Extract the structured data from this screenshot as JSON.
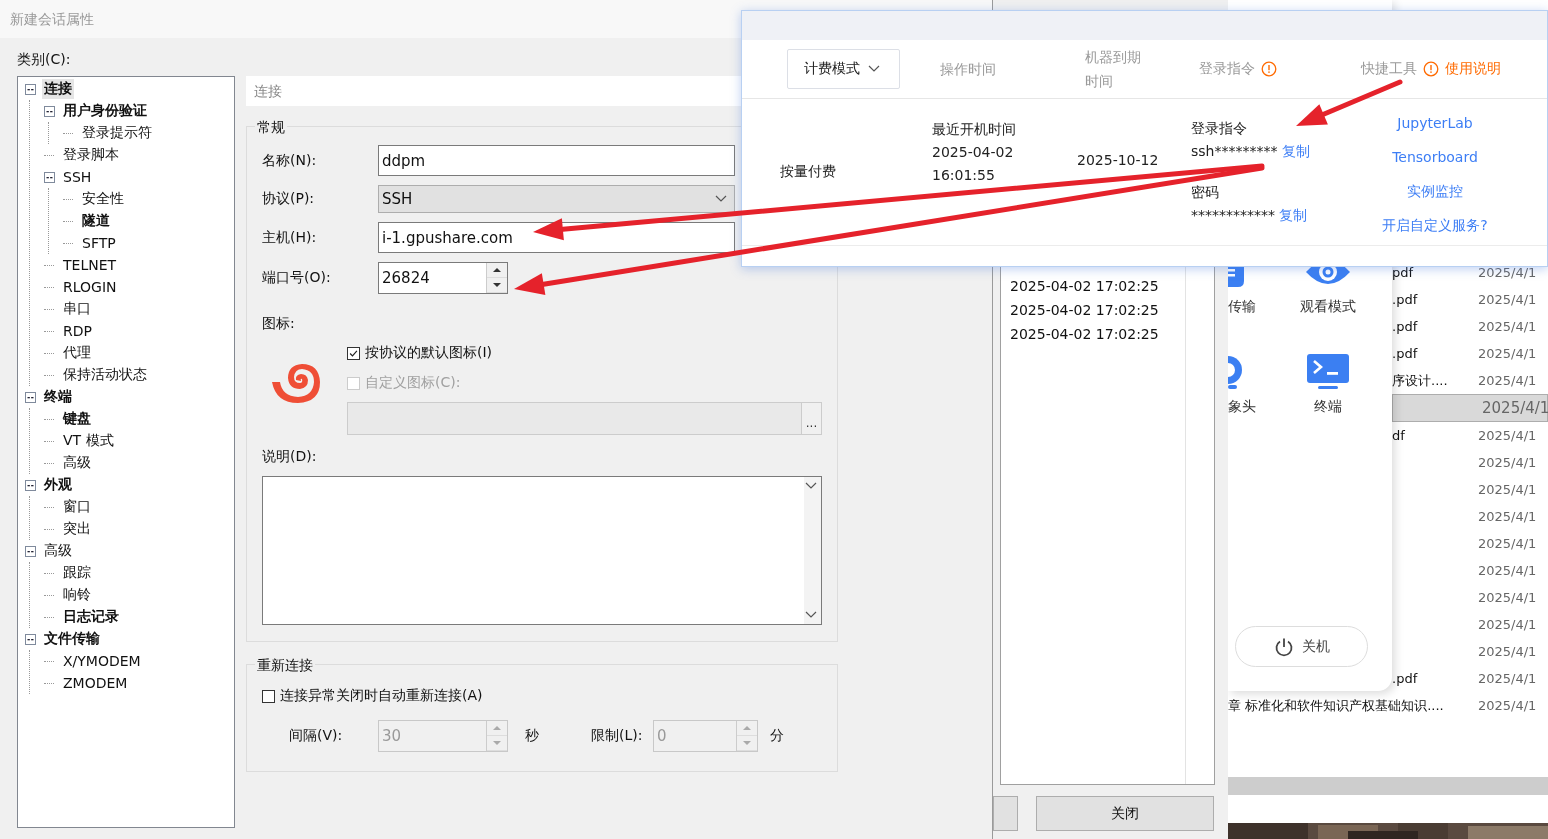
{
  "dialog": {
    "title": "新建会话属性",
    "category_label": "类别(C):",
    "tree": [
      {
        "label": "连接",
        "bold": true,
        "selected": true,
        "expanded": true,
        "children": [
          {
            "label": "用户身份验证",
            "bold": true,
            "selected": false,
            "expanded": true,
            "children": [
              {
                "label": "登录提示符",
                "bold": false,
                "selected": false
              }
            ]
          },
          {
            "label": "登录脚本",
            "bold": false,
            "selected": false
          },
          {
            "label": "SSH",
            "bold": false,
            "selected": false,
            "expanded": true,
            "children": [
              {
                "label": "安全性",
                "bold": false,
                "selected": false
              },
              {
                "label": "隧道",
                "bold": true,
                "selected": false
              },
              {
                "label": "SFTP",
                "bold": false,
                "selected": false
              }
            ]
          },
          {
            "label": "TELNET",
            "bold": false,
            "selected": false
          },
          {
            "label": "RLOGIN",
            "bold": false,
            "selected": false
          },
          {
            "label": "串口",
            "bold": false,
            "selected": false
          },
          {
            "label": "RDP",
            "bold": false,
            "selected": false
          },
          {
            "label": "代理",
            "bold": false,
            "selected": false
          },
          {
            "label": "保持活动状态",
            "bold": false,
            "selected": false
          }
        ]
      },
      {
        "label": "终端",
        "bold": true,
        "selected": false,
        "expanded": true,
        "children": [
          {
            "label": "键盘",
            "bold": true,
            "selected": false
          },
          {
            "label": "VT 模式",
            "bold": false,
            "selected": false
          },
          {
            "label": "高级",
            "bold": false,
            "selected": false
          }
        ]
      },
      {
        "label": "外观",
        "bold": true,
        "selected": false,
        "expanded": true,
        "children": [
          {
            "label": "窗口",
            "bold": false,
            "selected": false
          },
          {
            "label": "突出",
            "bold": false,
            "selected": false
          }
        ]
      },
      {
        "label": "高级",
        "bold": false,
        "selected": false,
        "expanded": true,
        "children": [
          {
            "label": "跟踪",
            "bold": false,
            "selected": false
          },
          {
            "label": "响铃",
            "bold": false,
            "selected": false
          },
          {
            "label": "日志记录",
            "bold": true,
            "selected": false
          }
        ]
      },
      {
        "label": "文件传输",
        "bold": true,
        "selected": false,
        "expanded": true,
        "children": [
          {
            "label": "X/YMODEM",
            "bold": false,
            "selected": false
          },
          {
            "label": "ZMODEM",
            "bold": false,
            "selected": false
          }
        ]
      }
    ],
    "section_header": "连接",
    "general": {
      "title": "常规",
      "fields": [
        {
          "kind": "text",
          "label": "名称(N):",
          "value": "ddpm"
        },
        {
          "kind": "select",
          "label": "协议(P):",
          "value": "SSH"
        },
        {
          "kind": "text",
          "label": "主机(H):",
          "value": "i-1.gpushare.com"
        },
        {
          "kind": "spin",
          "label": "端口号(O):",
          "value": "26824"
        }
      ],
      "icon_label": "图标:",
      "default_icon": {
        "label": "按协议的默认图标(I)",
        "checked": true,
        "disabled": false
      },
      "custom_icon": {
        "label": "自定义图标(C):",
        "checked": false,
        "disabled": true
      },
      "browse_button": "...",
      "description_label": "说明(D):"
    },
    "reconnect": {
      "title": "重新连接",
      "auto": {
        "label": "连接异常关闭时自动重新连接(A)",
        "checked": false,
        "disabled": false
      },
      "interval": {
        "label": "间隔(V):",
        "value": "30",
        "unit": "秒",
        "disabled": true
      },
      "limit": {
        "label": "限制(L):",
        "value": "0",
        "unit": "分",
        "disabled": true
      }
    }
  },
  "session_window": {
    "timestamps": [
      "2025-04-02 17:02:25",
      "2025-04-02 17:02:25",
      "2025-04-02 17:02:25"
    ],
    "close_button": "关闭"
  },
  "tool_panel": {
    "tools": [
      {
        "label": "传输",
        "kind": "upload"
      },
      {
        "label": "观看模式",
        "kind": "eye"
      },
      {
        "label": "象头",
        "kind": "webcam"
      },
      {
        "label": "终端",
        "kind": "terminal"
      }
    ],
    "shutdown": "关机"
  },
  "file_list": {
    "rows": [
      {
        "kind": "cut",
        "name": "pdf",
        "date": "2025/4/1",
        "selected": false
      },
      {
        "kind": "cut",
        "name": ".pdf",
        "date": "2025/4/1",
        "selected": false
      },
      {
        "kind": "cut",
        "name": ".pdf",
        "date": "2025/4/1",
        "selected": false
      },
      {
        "kind": "cut",
        "name": ".pdf",
        "date": "2025/4/1",
        "selected": false
      },
      {
        "kind": "cut",
        "name": "序设计....",
        "date": "2025/4/1",
        "selected": false
      },
      {
        "kind": "cut",
        "date": "2025/4/1",
        "selected": true
      },
      {
        "kind": "cut",
        "name": "df",
        "date": "2025/4/1",
        "selected": false
      },
      {
        "kind": "cut",
        "date": "2025/4/1",
        "selected": false
      },
      {
        "kind": "cut",
        "date": "2025/4/1",
        "selected": false
      },
      {
        "kind": "cut",
        "date": "2025/4/1",
        "selected": false
      },
      {
        "kind": "cut",
        "date": "2025/4/1",
        "selected": false
      },
      {
        "kind": "cut",
        "date": "2025/4/1",
        "selected": false
      },
      {
        "kind": "cut",
        "date": "2025/4/1",
        "selected": false
      },
      {
        "kind": "cut",
        "date": "2025/4/1",
        "selected": false
      },
      {
        "kind": "cut",
        "date": "2025/4/1",
        "selected": false
      },
      {
        "kind": "cut",
        "name": ".pdf",
        "date": "2025/4/1",
        "selected": false
      },
      {
        "kind": "full",
        "name": "章 标准化和软件知识产权基础知识....",
        "date": "2025/4/1",
        "selected": false
      }
    ]
  },
  "popup": {
    "headers": [
      {
        "kind": "dropdown",
        "label": "计费模式"
      },
      {
        "kind": "plain",
        "label": "操作时间"
      },
      {
        "kind": "plain",
        "label": "机器到期时间"
      },
      {
        "kind": "info",
        "label": "登录指令"
      },
      {
        "kind": "info_link",
        "label": "快捷工具",
        "link": "使用说明"
      }
    ],
    "row": {
      "billing": "按量付费",
      "boot_label": "最近开机时间",
      "boot_time": "2025-04-02 16:01:55",
      "expiry": "2025-10-12",
      "login": [
        {
          "label": "登录指令",
          "value": "ssh*********",
          "action": "复制"
        },
        {
          "label": "密码",
          "value": "************",
          "action": "复制"
        }
      ],
      "tools": [
        "JupyterLab",
        "Tensorboard",
        "实例监控",
        "开启自定义服务?"
      ]
    }
  }
}
